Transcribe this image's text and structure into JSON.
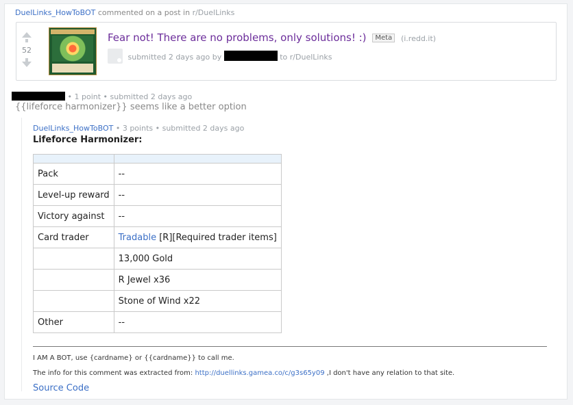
{
  "header": {
    "author": "DuelLinks_HowToBOT",
    "action": "commented on a post in",
    "subreddit": "r/DuelLinks"
  },
  "post": {
    "score": "52",
    "title": "Fear not! There are no problems, only solutions! :)",
    "flair": "Meta",
    "domain": "(i.redd.it)",
    "submitted_prefix": "submitted 2 days ago by",
    "to_subreddit": "to r/DuelLinks"
  },
  "parent_comment": {
    "meta": "• 1 point • submitted 2 days ago",
    "body": "{{lifeforce harmonizer}} seems like a better option"
  },
  "bot_comment": {
    "author": "DuelLinks_HowToBOT",
    "meta": "• 3 points • submitted 2 days ago",
    "card_title": "Lifeforce Harmonizer:",
    "table_rows": [
      {
        "key": "Pack",
        "value": "--"
      },
      {
        "key": "Level-up reward",
        "value": "--"
      },
      {
        "key": "Victory against",
        "value": "--"
      },
      {
        "key": "Card trader",
        "value_link": "Tradable",
        "value": "[R][Required trader items]"
      },
      {
        "key": "",
        "value": "13,000 Gold"
      },
      {
        "key": "",
        "value": "R Jewel x36"
      },
      {
        "key": "",
        "value": "Stone of Wind x22"
      },
      {
        "key": "Other",
        "value": "--"
      }
    ],
    "footer_line1": "I AM A BOT, use {cardname} or {{cardname}} to call me.",
    "footer_line2_prefix": "The info for this comment was extracted from:",
    "footer_link": "http://duellinks.gamea.co/c/g3s65y09",
    "footer_line2_suffix": ",I don't have any relation to that site.",
    "source_code": "Source Code"
  }
}
